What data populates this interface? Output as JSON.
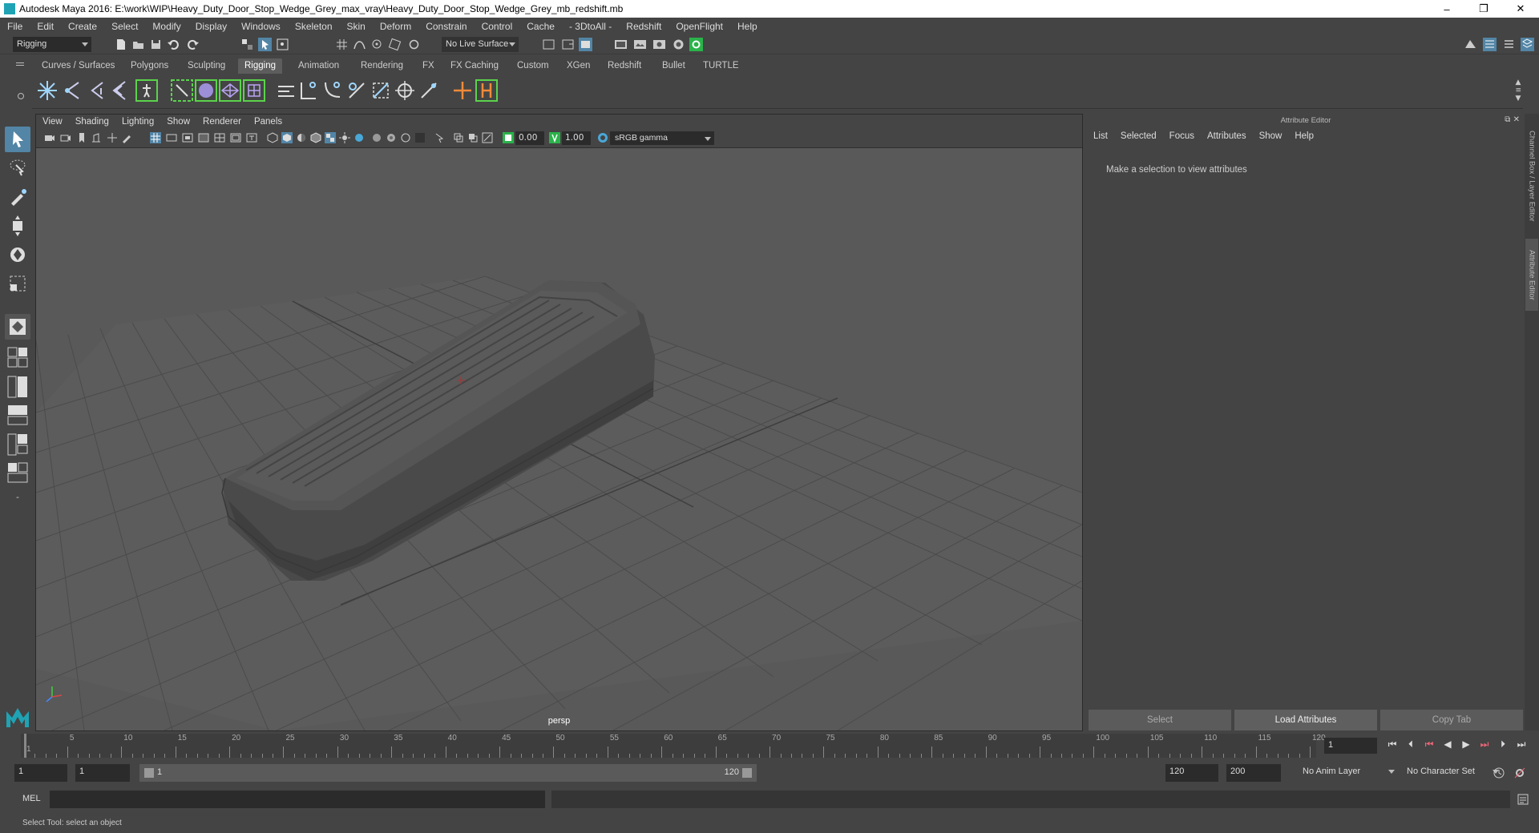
{
  "window": {
    "title": "Autodesk Maya 2016: E:\\work\\WIP\\Heavy_Duty_Door_Stop_Wedge_Grey_max_vray\\Heavy_Duty_Door_Stop_Wedge_Grey_mb_redshift.mb",
    "minimize": "–",
    "maximize": "❐",
    "close": "✕"
  },
  "menubar": [
    "File",
    "Edit",
    "Create",
    "Select",
    "Modify",
    "Display",
    "Windows",
    "Skeleton",
    "Skin",
    "Deform",
    "Constrain",
    "Control",
    "Cache",
    "- 3DtoAll -",
    "Redshift",
    "OpenFlight",
    "Help"
  ],
  "statusline": {
    "menuset": "Rigging",
    "live_surface": "No Live Surface"
  },
  "shelf_tabs": [
    "Curves / Surfaces",
    "Polygons",
    "Sculpting",
    "Rigging",
    "Animation",
    "Rendering",
    "FX",
    "FX Caching",
    "Custom",
    "XGen",
    "Redshift",
    "Bullet",
    "TURTLE"
  ],
  "shelf_active": "Rigging",
  "viewport": {
    "menu": [
      "View",
      "Shading",
      "Lighting",
      "Show",
      "Renderer",
      "Panels"
    ],
    "exposure": "0.00",
    "gamma": "1.00",
    "colorspace": "sRGB gamma",
    "camera": "persp"
  },
  "attribute_editor": {
    "header": "Attribute Editor",
    "menu": [
      "List",
      "Selected",
      "Focus",
      "Attributes",
      "Show",
      "Help"
    ],
    "message": "Make a selection to view attributes",
    "buttons": [
      "Select",
      "Load Attributes",
      "Copy Tab"
    ]
  },
  "side_tabs": [
    "Channel Box / Layer Editor",
    "Attribute Editor"
  ],
  "timeline": {
    "labels": [
      "1",
      "5",
      "10",
      "15",
      "20",
      "25",
      "30",
      "35",
      "40",
      "45",
      "50",
      "55",
      "60",
      "65",
      "70",
      "75",
      "80",
      "85",
      "90",
      "95",
      "100",
      "105",
      "110",
      "115",
      "120"
    ],
    "current_frame": "1"
  },
  "range": {
    "start": "1",
    "playback_start": "1",
    "slider_start": "1",
    "slider_end": "120",
    "playback_end": "120",
    "end": "200",
    "anim_layer": "No Anim Layer",
    "character_set": "No Character Set"
  },
  "command": {
    "lang": "MEL"
  },
  "help_line": "Select Tool: select an object",
  "colors": {
    "accent_teal": "#1fa3b4",
    "shelf_green": "#5bd34c",
    "viewport_bg": "#595959",
    "grid": "#474747"
  }
}
